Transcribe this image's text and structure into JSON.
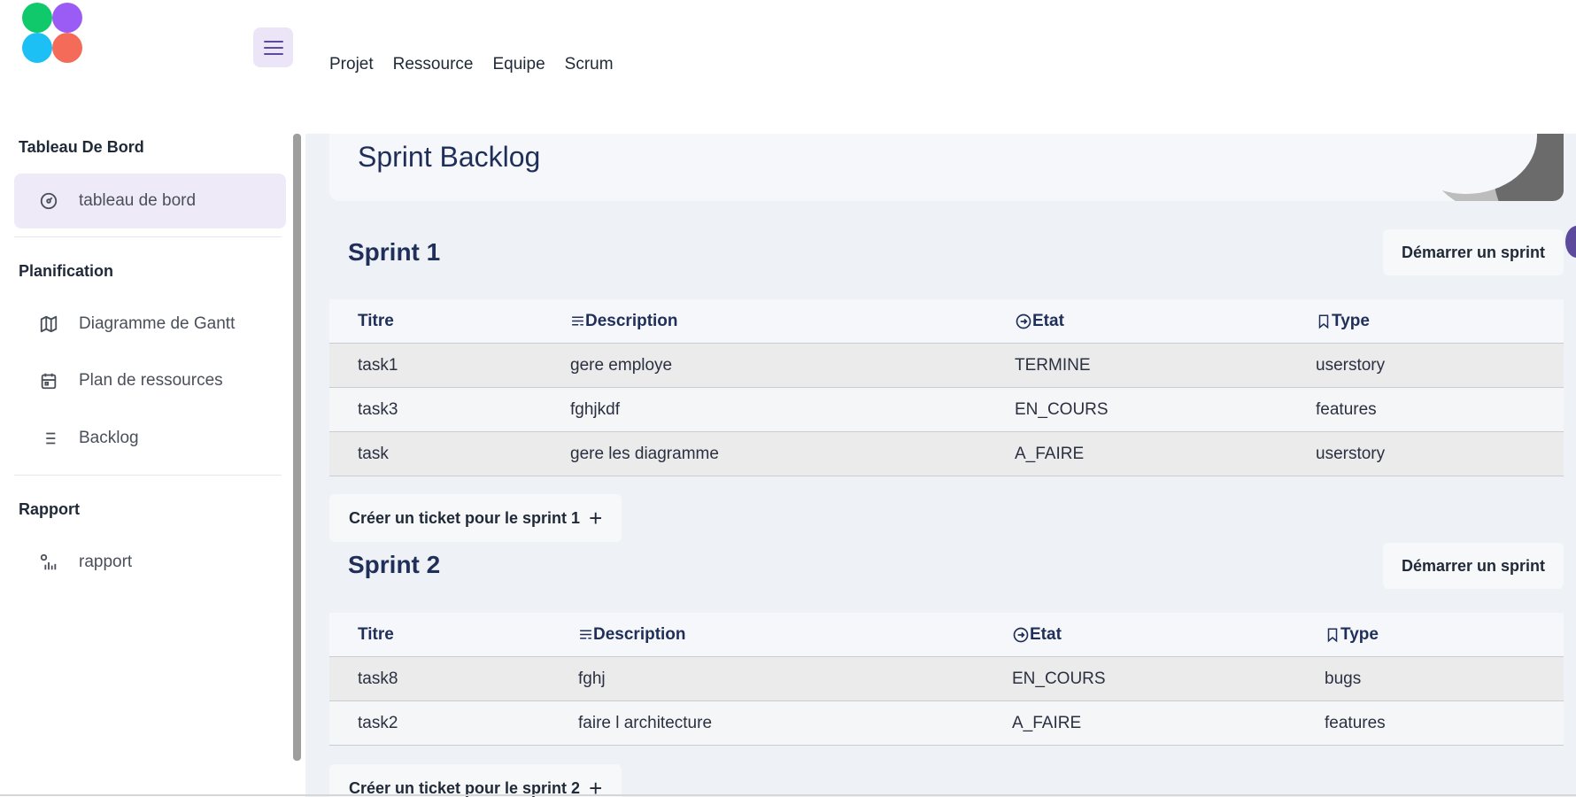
{
  "header": {
    "logo_colors": [
      "#10c96b",
      "#9b5cf6",
      "#1cc0f5",
      "#f46b5a"
    ],
    "nav": [
      "Projet",
      "Ressource",
      "Equipe",
      "Scrum"
    ]
  },
  "sidebar": {
    "sections": [
      {
        "title": "Tableau De Bord",
        "items": [
          {
            "label": "tableau de bord",
            "icon": "dashboard-icon",
            "active": true
          }
        ]
      },
      {
        "title": "Planification",
        "items": [
          {
            "label": "Diagramme de Gantt",
            "icon": "map-icon"
          },
          {
            "label": "Plan de ressources",
            "icon": "calendar-icon"
          },
          {
            "label": "Backlog",
            "icon": "list-icon"
          }
        ]
      },
      {
        "title": "Rapport",
        "items": [
          {
            "label": "rapport",
            "icon": "report-chart-icon"
          }
        ]
      }
    ]
  },
  "page": {
    "title": "Sprint Backlog"
  },
  "table_headers": {
    "titre": "Titre",
    "description": "Description",
    "etat": "Etat",
    "type": "Type"
  },
  "sprints": [
    {
      "title": "Sprint 1",
      "start_label": "Démarrer un sprint",
      "create_label": "Créer un ticket pour le sprint 1",
      "rows": [
        [
          "task1",
          "gere employe",
          "TERMINE",
          "userstory"
        ],
        [
          "task3",
          "fghjkdf",
          "EN_COURS",
          "features"
        ],
        [
          "task",
          "gere les diagramme",
          "A_FAIRE",
          "userstory"
        ]
      ]
    },
    {
      "title": "Sprint 2",
      "start_label": "Démarrer un sprint",
      "create_label": "Créer un ticket pour le sprint 2",
      "rows": [
        [
          "task8",
          "fghj",
          "EN_COURS",
          "bugs"
        ],
        [
          "task2",
          "faire l architecture",
          "A_FAIRE",
          "features"
        ]
      ]
    }
  ],
  "colors": {
    "accent": "#5c4a9c",
    "active_bg": "#efeaf7",
    "title": "#1f2f5a"
  }
}
